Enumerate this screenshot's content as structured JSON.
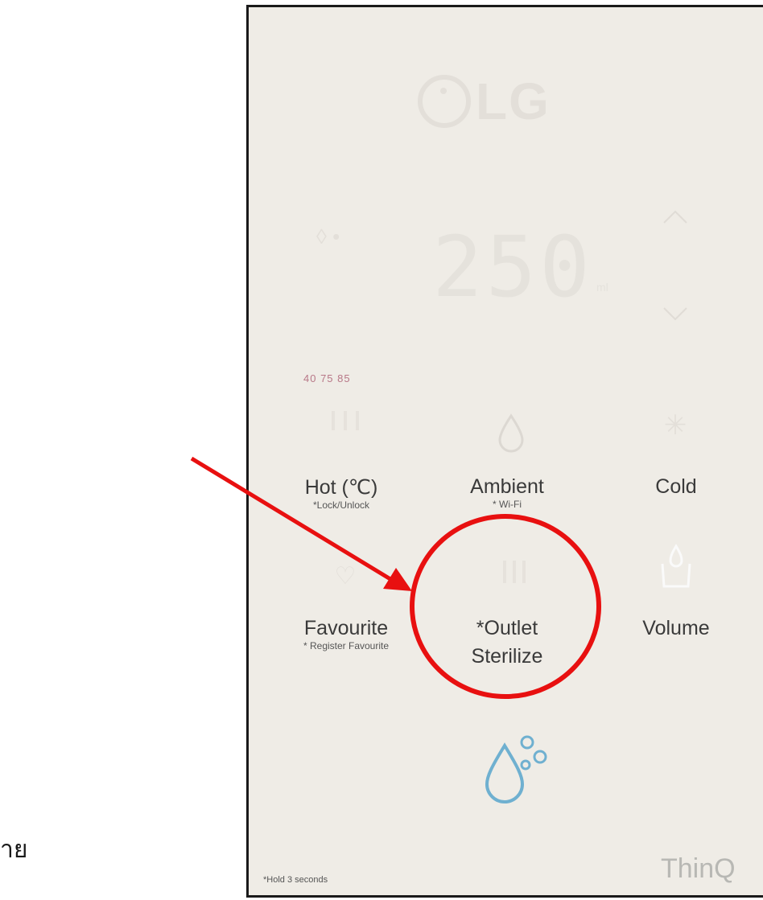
{
  "panel": {
    "logo_text": "LG",
    "display_value": "250",
    "display_unit": "ml",
    "temperature_options": "40  75  85",
    "buttons": {
      "hot": {
        "label": "Hot (℃)",
        "sub": "*Lock/Unlock"
      },
      "ambient": {
        "label": "Ambient",
        "sub": "* Wi-Fi"
      },
      "cold": {
        "label": "Cold"
      },
      "favourite": {
        "label": "Favourite",
        "sub": "* Register Favourite"
      },
      "outlet": {
        "label_line1": "*Outlet",
        "label_line2": "Sterilize"
      },
      "volume": {
        "label": "Volume"
      }
    },
    "hold_note": "*Hold 3 seconds",
    "brand_bottom": "ThinQ"
  },
  "thai_text": "าย",
  "annotation": {
    "color": "#e81010"
  },
  "colors": {
    "panel_bg": "#efece6",
    "sterilize_icon": "#6fb0d0",
    "temperature_text": "#b87888"
  },
  "icons": [
    "lg-logo-icon",
    "chevron-up-icon",
    "chevron-down-icon",
    "water-drop-icon",
    "snowflake-icon",
    "hot-water-icon",
    "favourite-icon",
    "outlet-icon",
    "volume-cup-icon",
    "sterilize-drops-icon"
  ]
}
